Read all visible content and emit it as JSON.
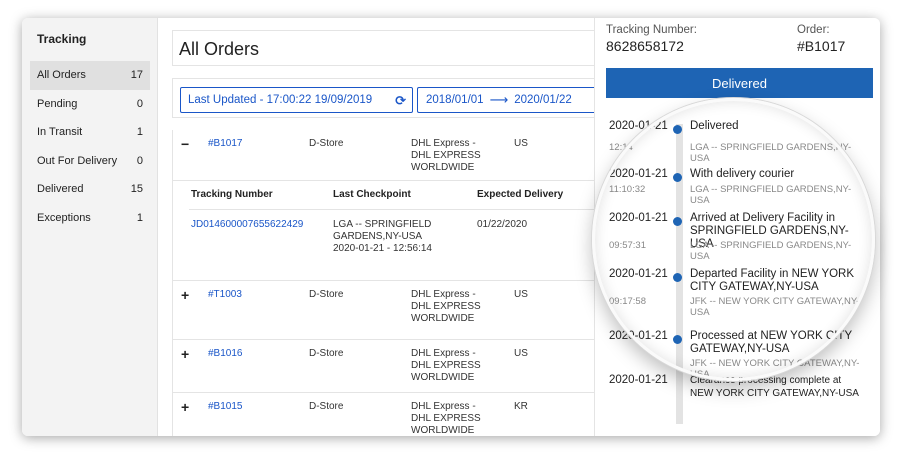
{
  "sidebar": {
    "title": "Tracking",
    "items": [
      {
        "label": "All Orders",
        "count": "17"
      },
      {
        "label": "Pending",
        "count": "0"
      },
      {
        "label": "In Transit",
        "count": "1"
      },
      {
        "label": "Out For Delivery",
        "count": "0"
      },
      {
        "label": "Delivered",
        "count": "15"
      },
      {
        "label": "Exceptions",
        "count": "1"
      }
    ]
  },
  "main": {
    "title": "All Orders",
    "last_updated": "Last Updated - 17:00:22 19/09/2019",
    "refresh_icon": "refresh-icon",
    "date_from": "2018/01/01",
    "date_to": "2020/01/22",
    "orders": [
      {
        "toggle": "−",
        "order": "#B1017",
        "store": "D-Store",
        "carrier": "DHL Express - DHL EXPRESS WORLDWIDE",
        "country": "US"
      },
      {
        "toggle": "+",
        "order": "#T1003",
        "store": "D-Store",
        "carrier": "DHL Express - DHL EXPRESS WORLDWIDE",
        "country": "US"
      },
      {
        "toggle": "+",
        "order": "#B1016",
        "store": "D-Store",
        "carrier": "DHL Express - DHL EXPRESS WORLDWIDE",
        "country": "US"
      },
      {
        "toggle": "+",
        "order": "#B1015",
        "store": "D-Store",
        "carrier": "DHL Express - DHL EXPRESS WORLDWIDE",
        "country": "KR"
      }
    ],
    "detail": {
      "headers": [
        "Tracking Number",
        "Last Checkpoint",
        "Expected Delivery"
      ],
      "tracking_number": "JD014600007655622429",
      "checkpoint": "LGA -- SPRINGFIELD GARDENS,NY-USA",
      "checkpoint_time": "2020-01-21 - 12:56:14",
      "expected": "01/22/2020"
    }
  },
  "panel": {
    "tracking_label": "Tracking Number:",
    "tracking_number": "8628658172",
    "order_label": "Order:",
    "order_value": "#B1017",
    "status": "Delivered",
    "status_color": "#1e64b4",
    "events": [
      {
        "date": "2020-01-21",
        "time": "12:14",
        "title": "Delivered",
        "location": "LGA -- SPRINGFIELD GARDENS,NY-USA"
      },
      {
        "date": "2020-01-21",
        "time": "11:10:32",
        "title": "With delivery courier",
        "location": "LGA -- SPRINGFIELD GARDENS,NY-USA"
      },
      {
        "date": "2020-01-21",
        "time": "09:57:31",
        "title": "Arrived at Delivery Facility in SPRINGFIELD GARDENS,NY-USA",
        "location": "LGA -- SPRINGFIELD GARDENS,NY-USA"
      },
      {
        "date": "2020-01-21",
        "time": "09:17:58",
        "title": "Departed Facility in NEW YORK CITY GATEWAY,NY-USA",
        "location": "JFK -- NEW YORK CITY GATEWAY,NY-USA"
      },
      {
        "date": "2020-01-21",
        "time": "",
        "title": "Processed at NEW YORK CITY GATEWAY,NY-USA",
        "location": "JFK -- NEW YORK CITY GATEWAY,NY-USA"
      },
      {
        "date": "2020-01-21",
        "time": "",
        "title": "Clearance processing complete at NEW YORK CITY GATEWAY,NY-USA",
        "location": ""
      }
    ]
  }
}
